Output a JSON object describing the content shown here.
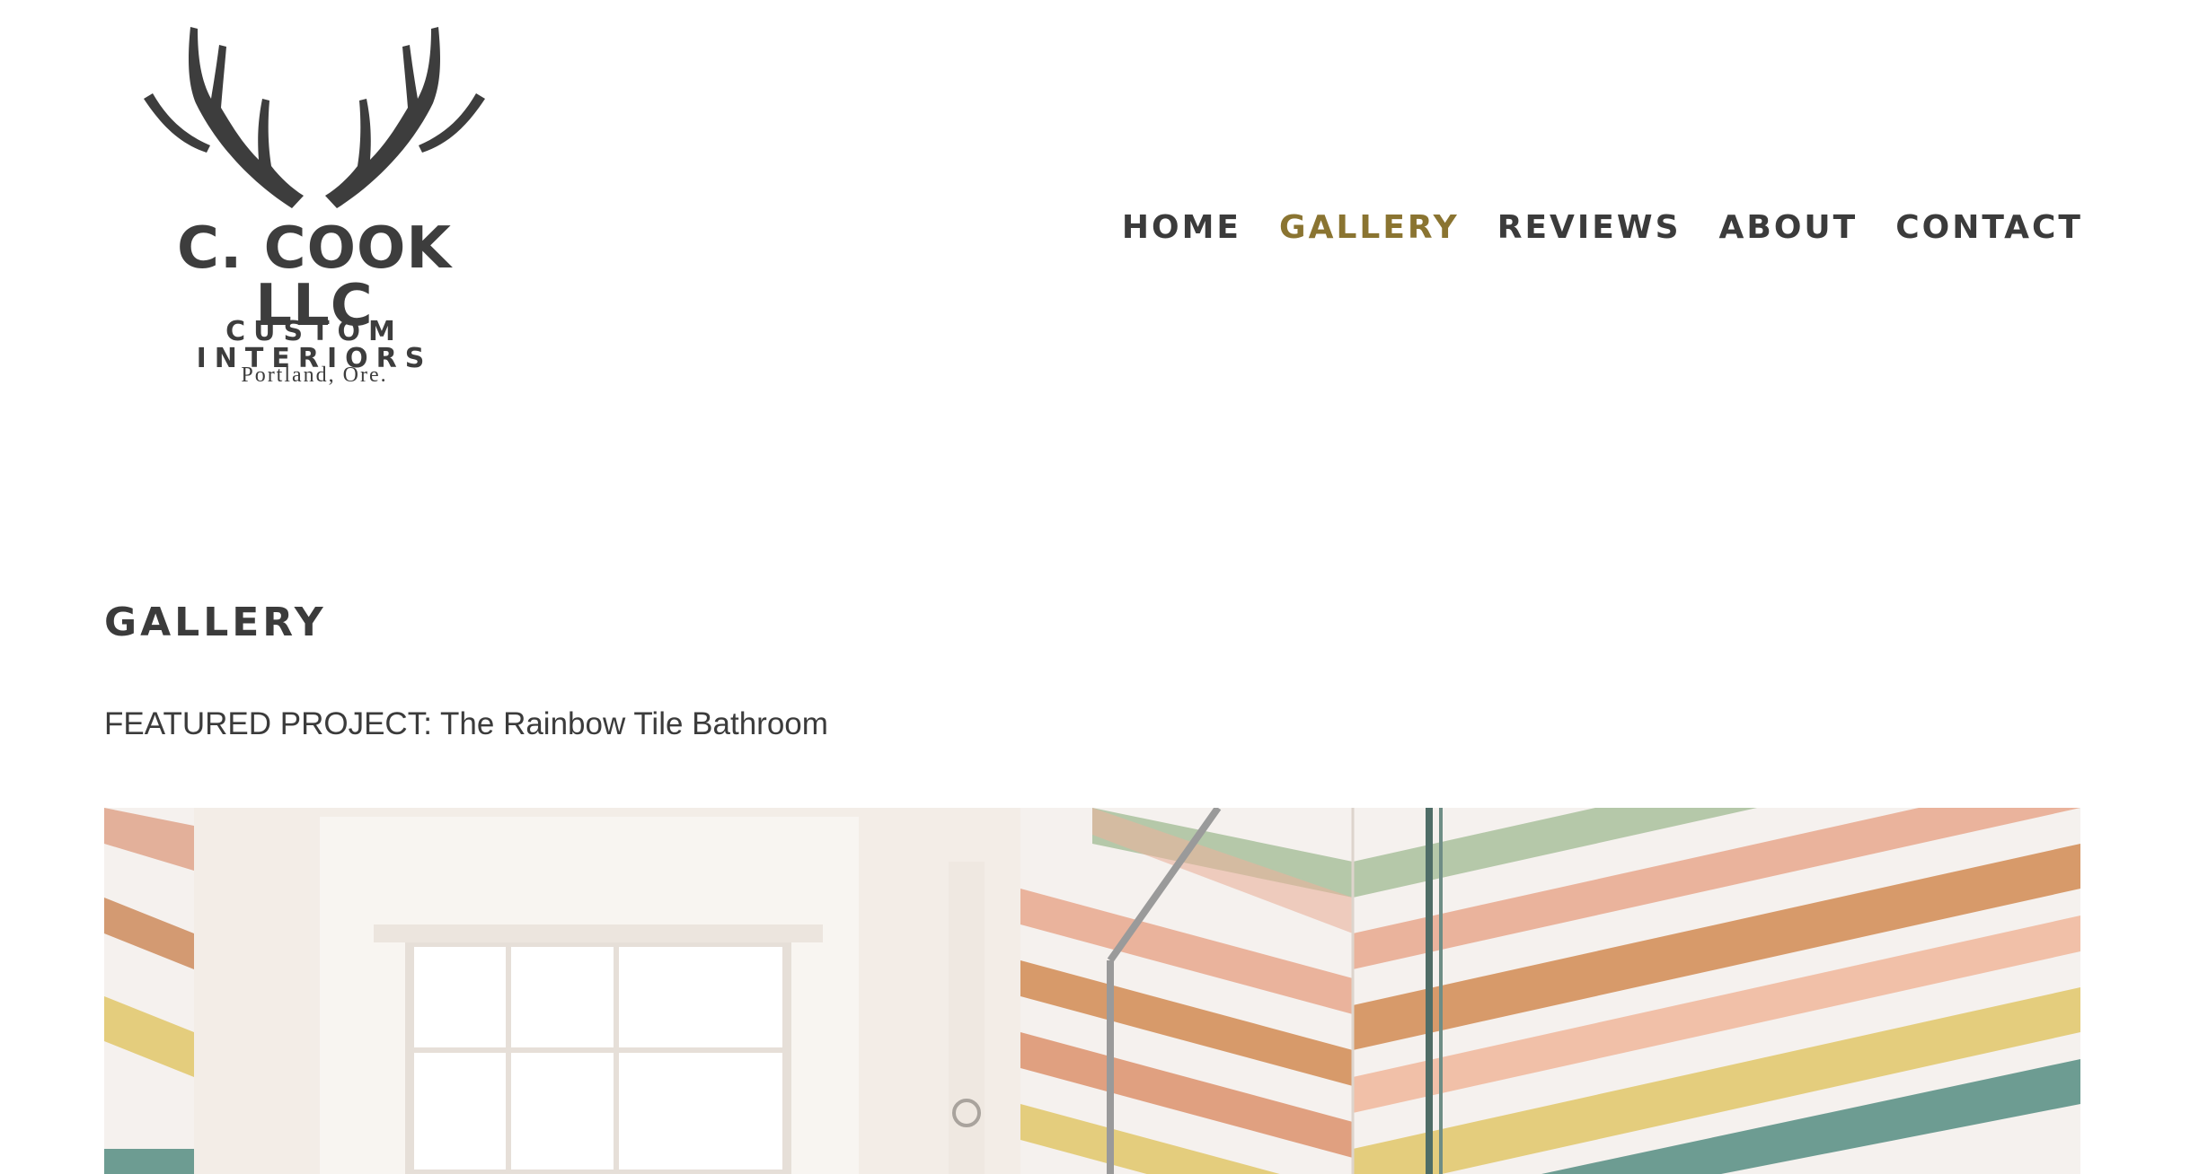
{
  "logo": {
    "brand": "C. COOK LLC",
    "tagline": "CUSTOM INTERIORS",
    "city": "Portland, Ore."
  },
  "nav": {
    "items": [
      {
        "label": "HOME",
        "active": false
      },
      {
        "label": "GALLERY",
        "active": true
      },
      {
        "label": "REVIEWS",
        "active": false
      },
      {
        "label": "ABOUT",
        "active": false
      },
      {
        "label": "CONTACT",
        "active": false
      }
    ]
  },
  "page": {
    "title": "GALLERY",
    "featured": "FEATURED PROJECT: The Rainbow Tile Bathroom"
  },
  "colors": {
    "text": "#3b3b3b",
    "nav_active": "#8a7431",
    "tile_pink": "#eab39c",
    "tile_orange": "#d79a6a",
    "tile_yellow": "#e4cd7d",
    "tile_green": "#b5c8a9",
    "tile_teal": "#6d9c92",
    "tile_white": "#f5f1ee"
  }
}
